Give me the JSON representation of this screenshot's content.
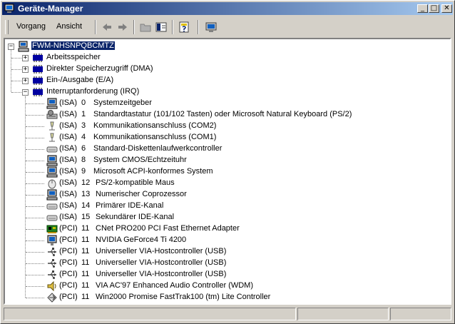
{
  "window": {
    "title": "Geräte-Manager"
  },
  "menu": {
    "vorgang": "Vorgang",
    "ansicht": "Ansicht"
  },
  "tree": {
    "root": "FWM-NHSNPQBCMTZ",
    "categories": [
      {
        "label": "Arbeitsspeicher",
        "expanded": false
      },
      {
        "label": "Direkter Speicherzugriff (DMA)",
        "expanded": false
      },
      {
        "label": "Ein-/Ausgabe (E/A)",
        "expanded": false
      },
      {
        "label": "Interruptanforderung (IRQ)",
        "expanded": true
      }
    ],
    "irq_items": [
      {
        "bus": "(ISA)",
        "irq": "0",
        "name": "Systemzeitgeber",
        "icon": "computer-icon"
      },
      {
        "bus": "(ISA)",
        "irq": "1",
        "name": "Standardtastatur (101/102 Tasten) oder Microsoft Natural Keyboard (PS/2)",
        "icon": "keyboard-icon"
      },
      {
        "bus": "(ISA)",
        "irq": "3",
        "name": "Kommunikationsanschluss (COM2)",
        "icon": "port-icon"
      },
      {
        "bus": "(ISA)",
        "irq": "4",
        "name": "Kommunikationsanschluss (COM1)",
        "icon": "port-icon"
      },
      {
        "bus": "(ISA)",
        "irq": "6",
        "name": "Standard-Diskettenlaufwerkcontroller",
        "icon": "drive-controller-icon"
      },
      {
        "bus": "(ISA)",
        "irq": "8",
        "name": "System CMOS/Echtzeituhr",
        "icon": "computer-icon"
      },
      {
        "bus": "(ISA)",
        "irq": "9",
        "name": "Microsoft ACPI-konformes System",
        "icon": "computer-icon"
      },
      {
        "bus": "(ISA)",
        "irq": "12",
        "name": "PS/2-kompatible Maus",
        "icon": "mouse-icon"
      },
      {
        "bus": "(ISA)",
        "irq": "13",
        "name": "Numerischer Coprozessor",
        "icon": "computer-icon"
      },
      {
        "bus": "(ISA)",
        "irq": "14",
        "name": "Primärer IDE-Kanal",
        "icon": "drive-controller-icon"
      },
      {
        "bus": "(ISA)",
        "irq": "15",
        "name": "Sekundärer IDE-Kanal",
        "icon": "drive-controller-icon"
      },
      {
        "bus": "(PCI)",
        "irq": "11",
        "name": "CNet PRO200 PCI Fast Ethernet Adapter",
        "icon": "network-card-icon"
      },
      {
        "bus": "(PCI)",
        "irq": "11",
        "name": "NVIDIA GeForce4 Ti 4200",
        "icon": "monitor-icon"
      },
      {
        "bus": "(PCI)",
        "irq": "11",
        "name": "Universeller VIA-Hostcontroller (USB)",
        "icon": "usb-icon"
      },
      {
        "bus": "(PCI)",
        "irq": "11",
        "name": "Universeller VIA-Hostcontroller (USB)",
        "icon": "usb-icon"
      },
      {
        "bus": "(PCI)",
        "irq": "11",
        "name": "Universeller VIA-Hostcontroller (USB)",
        "icon": "usb-icon"
      },
      {
        "bus": "(PCI)",
        "irq": "11",
        "name": "VIA AC'97 Enhanced Audio Controller (WDM)",
        "icon": "speaker-icon"
      },
      {
        "bus": "(PCI)",
        "irq": "11",
        "name": "Win2000 Promise FastTrak100 (tm) Lite Controller",
        "icon": "scsi-controller-icon"
      }
    ]
  },
  "colors": {
    "titlebar_start": "#0a246a",
    "titlebar_end": "#a6caf0",
    "selection": "#0a246a",
    "face": "#d4d0c8"
  }
}
